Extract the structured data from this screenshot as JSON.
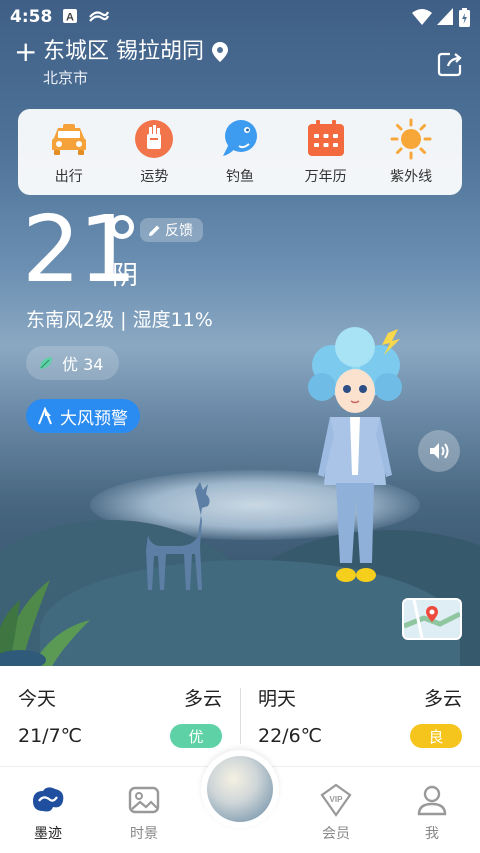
{
  "status_bar": {
    "time": "4:58"
  },
  "location": {
    "title": "东城区 锡拉胡同",
    "city": "北京市"
  },
  "shortcuts": [
    {
      "label": "出行",
      "icon": "car-icon"
    },
    {
      "label": "运势",
      "icon": "fortune-icon"
    },
    {
      "label": "钓鱼",
      "icon": "fish-icon"
    },
    {
      "label": "万年历",
      "icon": "calendar-icon"
    },
    {
      "label": "紫外线",
      "icon": "sun-icon"
    }
  ],
  "current": {
    "temperature": "21",
    "condition": "阴",
    "feedback_label": "反馈",
    "wind_humidity": "东南风2级 | 湿度11%",
    "aqi_label": "优 34",
    "alert_label": "大风预警"
  },
  "forecast": [
    {
      "day": "今天",
      "condition": "多云",
      "temp": "21/7℃",
      "aqi": "优",
      "aqi_color": "#5ed1a6"
    },
    {
      "day": "明天",
      "condition": "多云",
      "temp": "22/6℃",
      "aqi": "良",
      "aqi_color": "#f5c51e"
    }
  ],
  "tabs": [
    {
      "label": "墨迹",
      "icon": "moji-icon"
    },
    {
      "label": "时景",
      "icon": "photo-icon"
    },
    {
      "label": "会员",
      "icon": "vip-icon"
    },
    {
      "label": "我",
      "icon": "profile-icon"
    }
  ],
  "colors": {
    "accent": "#2a8bf0",
    "aqi_good": "#5ed1a6",
    "aqi_moderate": "#f5c51e",
    "shortcut_orange": "#f5a23b"
  }
}
